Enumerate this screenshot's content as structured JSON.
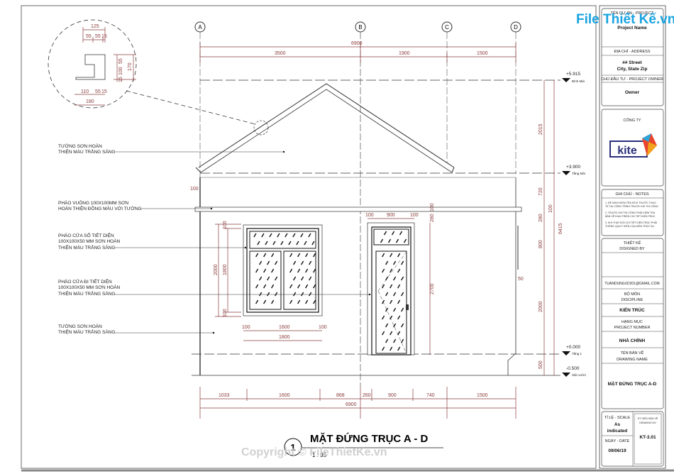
{
  "axes": [
    "A",
    "B",
    "C",
    "D"
  ],
  "top_dims": {
    "total": "6900",
    "parts": [
      "3500",
      "1900",
      "1500"
    ]
  },
  "bottom_dims": {
    "total": "6900",
    "parts": [
      "1033",
      "1600",
      "868",
      "260",
      "900",
      "740",
      "1500"
    ]
  },
  "right_dims": {
    "parts": [
      "2015",
      "720",
      "100",
      "280",
      "800",
      "2000",
      "500"
    ],
    "total": "6415"
  },
  "levels": [
    {
      "value": "+5.915",
      "name": "Đỉnh Mái"
    },
    {
      "value": "+3.900",
      "name": "Tầng Mái"
    },
    {
      "value": "+0.000",
      "name": "Tầng 1"
    },
    {
      "value": "-0.500",
      "name": "Sân vườn"
    }
  ],
  "detail": {
    "top": "125",
    "top_parts": [
      "55",
      "55",
      "15"
    ],
    "right": [
      "55",
      "100",
      "15"
    ],
    "right_total": "170",
    "bottom_parts": [
      "110",
      "55",
      "15"
    ],
    "bottom": "180"
  },
  "window_dims": {
    "height": "2000",
    "inner": "1800",
    "top": "100",
    "bottom": "100",
    "width": "1800",
    "w_parts": [
      "100",
      "1600",
      "100"
    ]
  },
  "door_dims": {
    "w_parts": [
      "100",
      "900",
      "100"
    ],
    "height": "2700",
    "v_small": [
      "280",
      "100"
    ]
  },
  "misc_dims": {
    "cornice": "100",
    "side": "50"
  },
  "notes": [
    [
      "TƯỜNG SƠN HOÀN",
      "THIỆN MÀU TRẮNG SÁNG"
    ],
    [
      "PHÀO VUÔNG 100X100MM SƠN",
      "HOÀN THIỆN ĐỒNG MÀU VỚI TƯỜNG"
    ],
    [
      "PHÀO CỬA SỔ TIẾT DIỆN",
      "100X100X50 MM SƠN HOÀN",
      "THIỆN MÀU TRẮNG SÁNG"
    ],
    [
      "PHÀO CỬA ĐI TIẾT DIỆN",
      "100X100X50 MM SƠN HOÀN",
      "THIỆN MÀU TRẮNG SÁNG"
    ],
    [
      "TƯỜNG SƠN HOÀN",
      "THIỆN MÀU TRẮNG SÁNG"
    ]
  ],
  "drawing_title": "MẶT ĐỨNG TRỤC A - D",
  "drawing_number": "1",
  "drawing_scale": "1 : 35",
  "watermark": {
    "logo": "File Thiết Kế.vn",
    "copyright": "Copyright © FileThietKe.vn"
  },
  "title_block": {
    "project_label": "TÊN DỰ ÁN - PROJECT",
    "project_name": "Project Name",
    "address_label": "ĐỊA CHỈ - ADDRESS",
    "address_1": "## Street",
    "address_2": "City, State  Zip",
    "owner_label": "CHỦ ĐẦU TƯ - PROJECT OWNER",
    "owner": "Owner",
    "company_label": "CÔNG TY",
    "company_logo": "kite",
    "notes_label": "GHI CHÚ - NOTES",
    "notes": [
      [
        "1. ĐỀ NGHỊ KIỂM TRA KÍCH THƯỚC THỰC",
        "TẾ TẠI CÔNG TRÌNH TRƯỚC KHI THI CÔNG"
      ],
      [
        "2. TRƯỚC KHI THI CÔNG PHẢI KIỂM TRA",
        "BẢN VẼ KHAI TRIỂN CHI TIẾT KIẾN TRÚC"
      ],
      [
        "3. KHI THAY ĐỔI CHI TIẾT KIẾN TRÚC PHẢI",
        "THÔNG QUA Ý KIẾN CỦA KIẾN TRÚC SƯ"
      ]
    ],
    "designed_label_1": "THIẾT KẾ",
    "designed_label_2": "DISIGNED BY",
    "email": "TUANDUNGXD201@GMAIL.COM",
    "discipline_label_1": "BỘ MÔN",
    "discipline_label_2": "DISCIPLINE",
    "discipline": "KIẾN TRÚC",
    "project_number_label_1": "HẠNG MỤC",
    "project_number_label_2": "PROJECT NUMBER",
    "project_number": "NHÀ CHÍNH",
    "drawing_name_label_1": "TÊN BẢN VẼ",
    "drawing_name_label_2": "DRAWING NAME",
    "drawing_name": "MẶT ĐỨNG TRỤC A-D",
    "scale_label": "TỈ LỆ - SCALE",
    "scale_1": "As",
    "scale_2": "indicated",
    "date_label": "NGÀY - DATE",
    "date": "09/06/19",
    "drawing_no_label_1": "KÝ HIỆU BẢN VẼ",
    "drawing_no_label_2": "DRAWING NO",
    "drawing_no": "KT-3.01"
  },
  "colors": {
    "dimension": "#8a3b3b",
    "line": "#333333",
    "logo_blue": "#1aa3e0",
    "kite_navy": "#2b2f7a"
  }
}
